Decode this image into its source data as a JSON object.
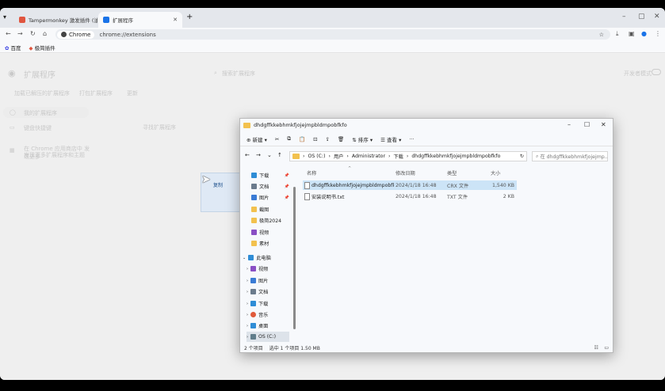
{
  "browser": {
    "tabs": [
      {
        "label": "Tampermonkey 激发插件 (油猴..."
      },
      {
        "label": "扩展程序"
      }
    ],
    "omnibox": {
      "chip": "Chrome",
      "url": "chrome://extensions"
    },
    "bookmarks": [
      {
        "label": "百度"
      },
      {
        "label": "极简插件"
      }
    ],
    "icon_colors": {
      "tab1": "#e0553f",
      "tab2": "#1a73e8"
    }
  },
  "ext_page": {
    "title": "扩展程序",
    "search_placeholder": "搜索扩展程序",
    "dev_mode": "开发者模式",
    "load_unpacked": "加载已解压的扩展程序",
    "pack": "打包扩展程序",
    "update": "更新",
    "menu_my": "我的扩展程序",
    "menu_shortcuts": "键盘快捷键",
    "empty": "寻找扩展程序",
    "store_link": "在 Chrome 应用商店中 发现更多",
    "store_sub": "发现更多扩展程序和主题"
  },
  "drag_ghost": {
    "label": "复制"
  },
  "explorer": {
    "title": "dhdgffkkebhmkfjojejmpbldmpobfkfo",
    "cmd": {
      "new": "新建",
      "sort": "排序",
      "view": "查看",
      "more": "···"
    },
    "breadcrumb": [
      "OS (C:)",
      "用户",
      "Administrator",
      "下载",
      "dhdgffkkebhmkfjojejmpbldmpobfkfo"
    ],
    "search_placeholder": "在 dhdgffkkebhmkfjojejmp...",
    "nav": [
      {
        "label": "下载",
        "color": "#2f8dd6",
        "pinned": true
      },
      {
        "label": "文档",
        "color": "#6b7b8c",
        "pinned": true
      },
      {
        "label": "图片",
        "color": "#3a7bd5",
        "pinned": true
      },
      {
        "label": "截图",
        "color": "#f2c14e",
        "pinned": false
      },
      {
        "label": "极简2024",
        "color": "#f2c14e",
        "pinned": false
      },
      {
        "label": "视频",
        "color": "#8a4fc4",
        "pinned": false
      },
      {
        "label": "素材",
        "color": "#f2c14e",
        "pinned": false
      }
    ],
    "nav_pc": {
      "label": "此电脑"
    },
    "nav_pc_items": [
      {
        "label": "视频",
        "color": "#8a4fc4"
      },
      {
        "label": "图片",
        "color": "#3a7bd5"
      },
      {
        "label": "文档",
        "color": "#6b7b8c"
      },
      {
        "label": "下载",
        "color": "#2f8dd6"
      },
      {
        "label": "音乐",
        "color": "#e05a3a"
      },
      {
        "label": "桌面",
        "color": "#2f8dd6"
      },
      {
        "label": "OS (C:)",
        "color": "#607d8b"
      }
    ],
    "columns": [
      "名称",
      "修改日期",
      "类型",
      "大小"
    ],
    "files": [
      {
        "name": "dhdgffkkebhmkfjojejmpbldmpobfkfo...",
        "date": "2024/1/18 16:48",
        "type": "CRX 文件",
        "size": "1,540 KB",
        "selected": true
      },
      {
        "name": "安装说明书.txt",
        "date": "2024/1/18 16:48",
        "type": "TXT 文件",
        "size": "2 KB",
        "selected": false
      }
    ],
    "status": {
      "count": "2 个项目",
      "selection": "选中 1 个项目  1.50 MB"
    }
  }
}
